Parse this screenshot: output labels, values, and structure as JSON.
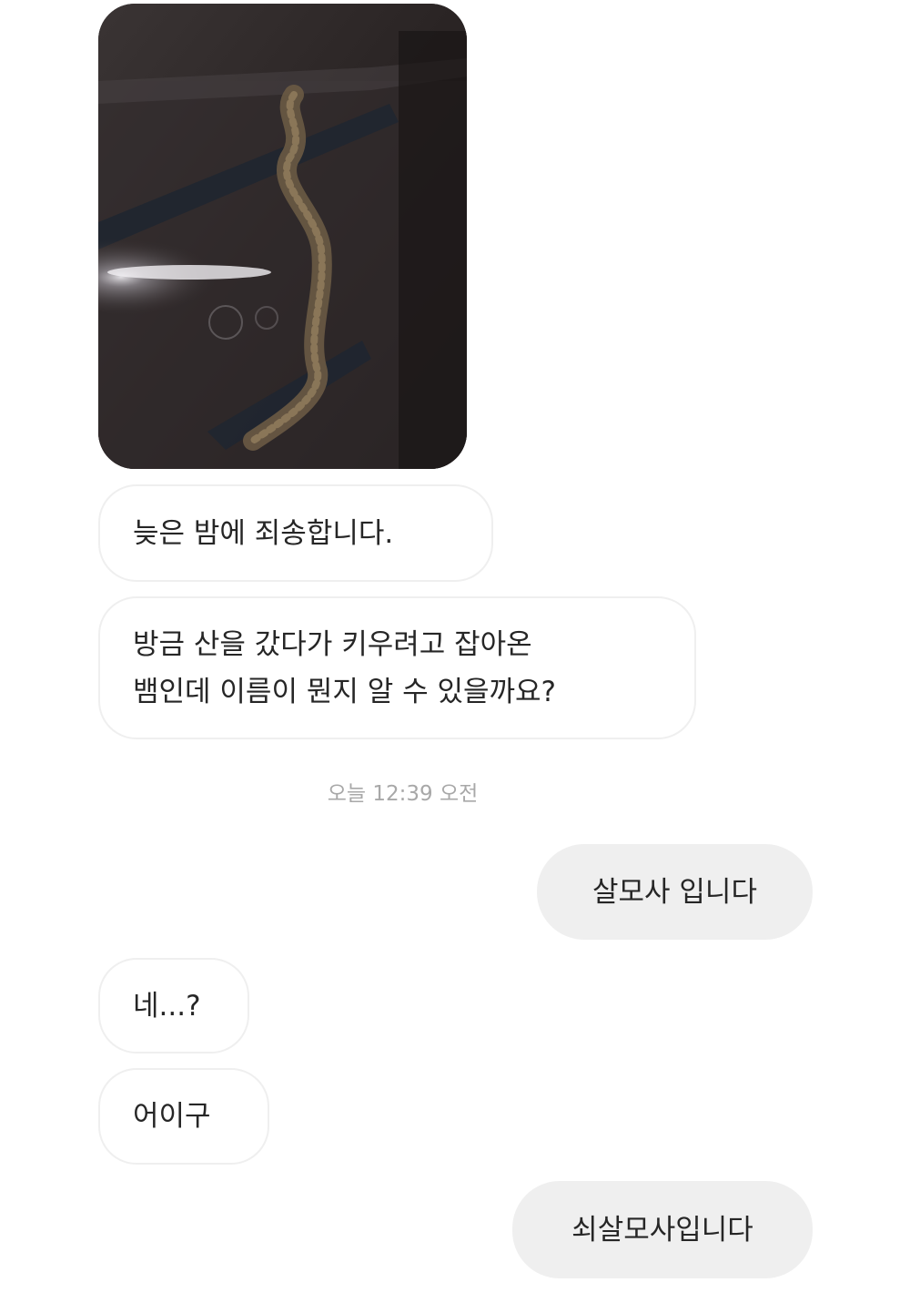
{
  "thread": {
    "messages": [
      {
        "sender": "them",
        "text": "늦은 밤에 죄송합니다."
      },
      {
        "sender": "them",
        "lines": [
          "방금 산을 갔다가 키우려고 잡아온",
          "뱀인데 이름이 뭔지 알 수 있을까요?"
        ]
      },
      {
        "sender": "me",
        "text": "살모사 입니다"
      },
      {
        "sender": "them",
        "text": "네...?"
      },
      {
        "sender": "them",
        "text": "어이구"
      },
      {
        "sender": "me",
        "text": "쇠살모사입니다"
      }
    ],
    "timestamp": "오늘 12:39 오전"
  },
  "colors": {
    "incoming_border": "#efefef",
    "outgoing_bg": "#efefef",
    "text": "#262626",
    "timestamp": "#a8a8a8"
  }
}
